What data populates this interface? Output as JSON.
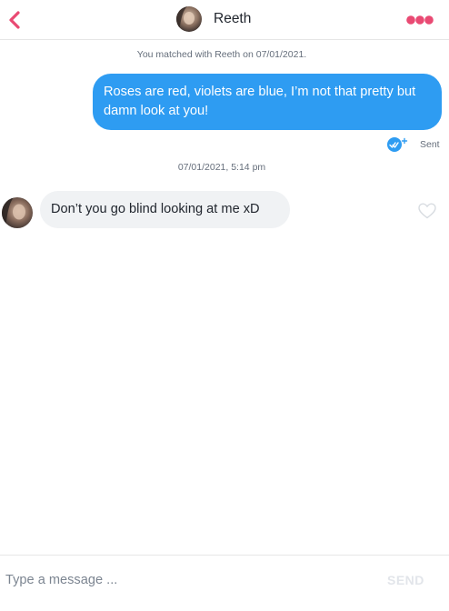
{
  "header": {
    "name": "Reeth",
    "back_icon": "chevron-left-icon",
    "more_icon": "more-dots-icon"
  },
  "colors": {
    "accent": "#e94a73",
    "outgoing_bubble": "#2e9cf2",
    "incoming_bubble": "#f0f2f4",
    "meta_text": "#656e7b"
  },
  "conversation": {
    "match_note": "You matched with Reeth on 07/01/2021.",
    "outgoing": {
      "text": "Roses are red, violets are blue, I’m not that pretty but damn look at you!",
      "status": "Sent",
      "status_icon": "double-check-icon"
    },
    "timestamp": "07/01/2021, 5:14 pm",
    "incoming": {
      "text": "Don’t you go blind looking at me xD",
      "like_icon": "heart-outline-icon"
    }
  },
  "composer": {
    "placeholder": "Type a message ...",
    "value": "",
    "send_label": "SEND"
  }
}
